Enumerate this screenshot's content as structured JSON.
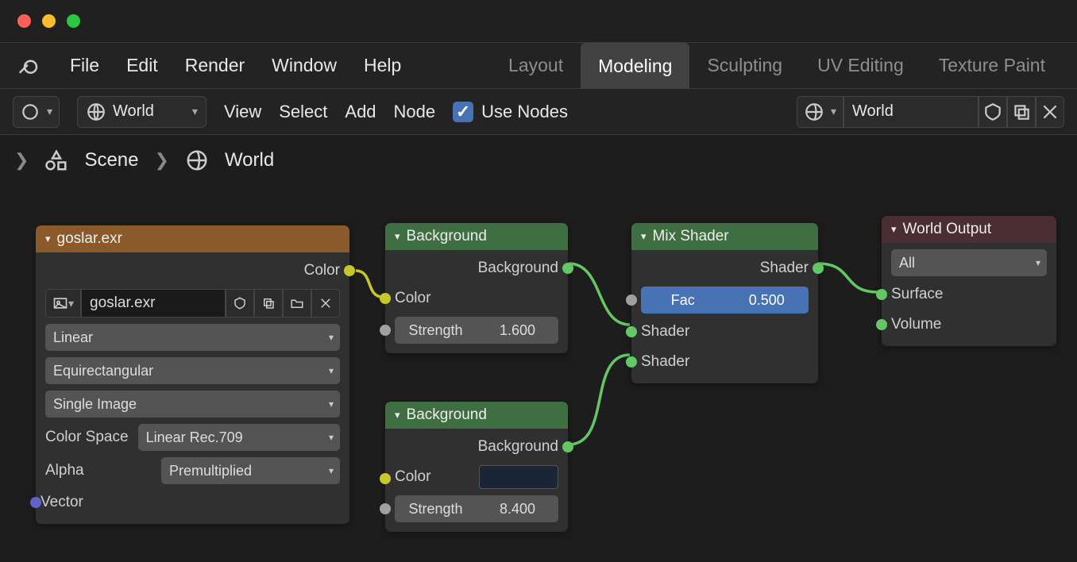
{
  "menubar": {
    "items": [
      "File",
      "Edit",
      "Render",
      "Window",
      "Help"
    ],
    "workspaces": [
      "Layout",
      "Modeling",
      "Sculpting",
      "UV Editing",
      "Texture Paint"
    ],
    "active_workspace": "Modeling"
  },
  "node_header": {
    "world_selector": "World",
    "menus": [
      "View",
      "Select",
      "Add",
      "Node"
    ],
    "use_nodes_label": "Use Nodes",
    "use_nodes_checked": true,
    "right_world": "World"
  },
  "breadcrumb": {
    "scene": "Scene",
    "world": "World"
  },
  "nodes": {
    "envtex": {
      "title": "goslar.exr",
      "out_color": "Color",
      "image_name": "goslar.exr",
      "interp": "Linear",
      "projection": "Equirectangular",
      "source": "Single Image",
      "colorspace_label": "Color Space",
      "colorspace": "Linear Rec.709",
      "alpha_label": "Alpha",
      "alpha": "Premultiplied",
      "vector": "Vector"
    },
    "bg1": {
      "title": "Background",
      "out": "Background",
      "color": "Color",
      "strength_label": "Strength",
      "strength": "1.600"
    },
    "bg2": {
      "title": "Background",
      "out": "Background",
      "color": "Color",
      "strength_label": "Strength",
      "strength": "8.400"
    },
    "mix": {
      "title": "Mix Shader",
      "out": "Shader",
      "fac_label": "Fac",
      "fac": "0.500",
      "shader1": "Shader",
      "shader2": "Shader"
    },
    "output": {
      "title": "World Output",
      "target": "All",
      "surface": "Surface",
      "volume": "Volume"
    }
  }
}
